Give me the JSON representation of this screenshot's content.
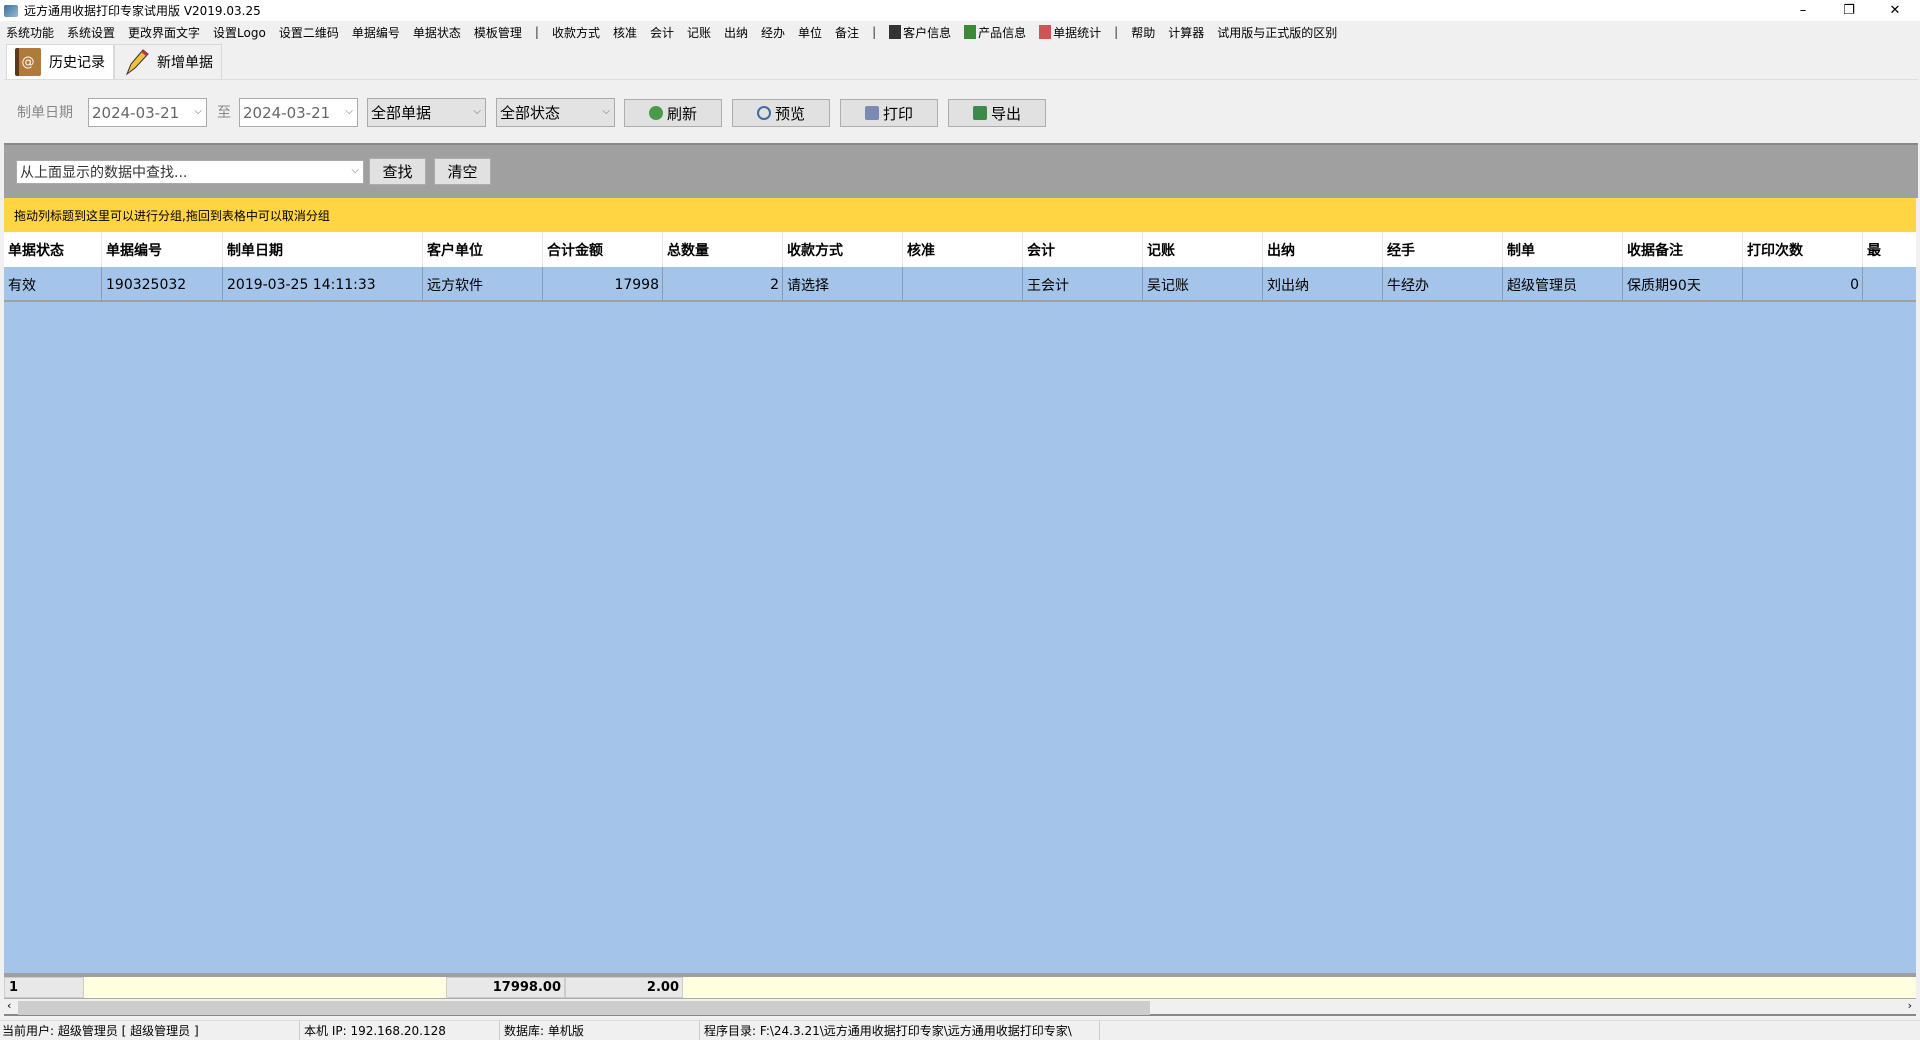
{
  "window": {
    "title": "远方通用收据打印专家试用版 V2019.03.25",
    "minimize": "–",
    "restore": "❐",
    "close": "✕"
  },
  "menu": {
    "items": [
      "系统功能",
      "系统设置",
      "更改界面文字",
      "设置Logo",
      "设置二维码",
      "单据编号",
      "单据状态",
      "模板管理",
      "|",
      "收款方式",
      "核准",
      "会计",
      "记账",
      "出纳",
      "经办",
      "单位",
      "备注",
      "|",
      "客户信息",
      "产品信息",
      "单据统计",
      "|",
      "帮助",
      "计算器",
      "试用版与正式版的区别"
    ]
  },
  "tabs": [
    {
      "label": "历史记录",
      "icon": "address-book-icon"
    },
    {
      "label": "新增单据",
      "icon": "pencil-icon"
    }
  ],
  "toolbar": {
    "date_label": "制单日期",
    "date_from": "2024-03-21",
    "to_label": "至",
    "date_to": "2024-03-21",
    "type_filter": "全部单据",
    "status_filter": "全部状态",
    "refresh": "刷新",
    "preview": "预览",
    "print": "打印",
    "export": "导出"
  },
  "search": {
    "placeholder": "从上面显示的数据中查找...",
    "find": "查找",
    "clear": "清空"
  },
  "group_hint": "拖动列标题到这里可以进行分组,拖回到表格中可以取消分组",
  "table": {
    "columns": [
      "单据状态",
      "单据编号",
      "制单日期",
      "客户单位",
      "合计金额",
      "总数量",
      "收款方式",
      "核准",
      "会计",
      "记账",
      "出纳",
      "经手",
      "制单",
      "收据备注",
      "打印次数",
      "最"
    ],
    "rows": [
      [
        "有效",
        "190325032",
        "2019-03-25 14:11:33",
        "远方软件",
        "17998",
        "2",
        "请选择",
        "",
        "王会计",
        "吴记账",
        "刘出纳",
        "牛经办",
        "超级管理员",
        "保质期90天",
        "0",
        ""
      ]
    ],
    "footer": {
      "count": "1",
      "total_amount": "17998.00",
      "total_qty": "2.00"
    }
  },
  "status": {
    "user": "当前用户: 超级管理员 [ 超级管理员 ]",
    "ip": "本机 IP: 192.168.20.128",
    "db": "数据库: 单机版",
    "dir": "程序目录: F:\\24.3.21\\远方通用收据打印专家\\远方通用收据打印专家\\"
  },
  "colors": {
    "group_band": "#ffd544",
    "grid_bg": "#a4c4ea",
    "footer_bg": "#ffffdf"
  }
}
